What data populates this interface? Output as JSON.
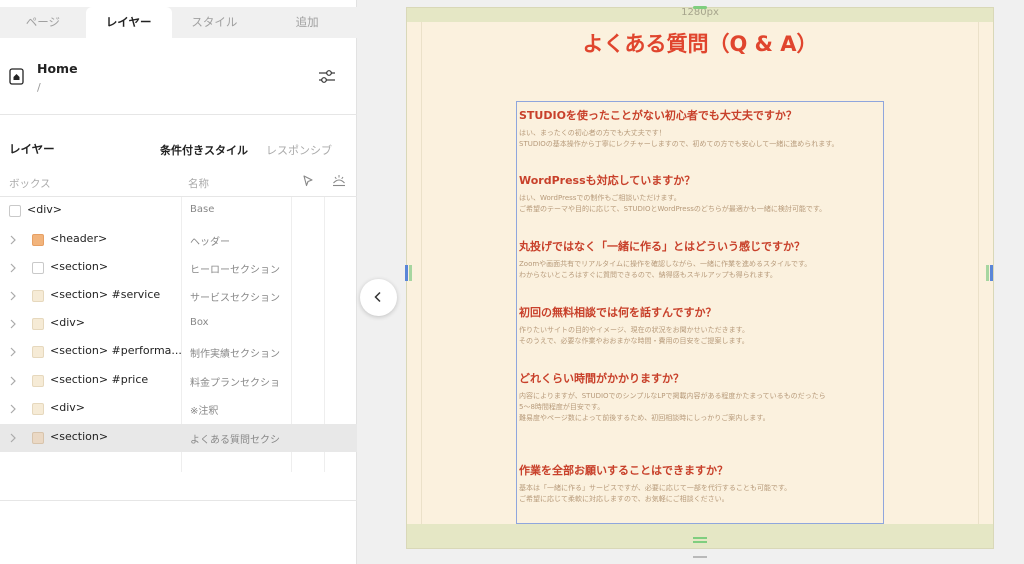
{
  "tabs": [
    {
      "label": "ページ"
    },
    {
      "label": "レイヤー"
    },
    {
      "label": "スタイル"
    },
    {
      "label": "追加"
    }
  ],
  "page": {
    "name": "Home",
    "path": "/"
  },
  "layer_panel": {
    "title": "レイヤー",
    "conditional_style": "条件付きスタイル",
    "responsive": "レスポンシブ",
    "col_box": "ボックス",
    "col_name": "名称"
  },
  "layers": [
    {
      "tag": "<div>",
      "name": "Base"
    },
    {
      "tag": "<header>",
      "name": "ヘッダー"
    },
    {
      "tag": "<section>",
      "name": "ヒーローセクション"
    },
    {
      "tag": "<section> #service",
      "name": "サービスセクション"
    },
    {
      "tag": "<div>",
      "name": "Box"
    },
    {
      "tag": "<section> #performa...",
      "name": "制作実績セクション"
    },
    {
      "tag": "<section> #price",
      "name": "料金プランセクショ"
    },
    {
      "tag": "<div>",
      "name": "※注釈"
    },
    {
      "tag": "<section>",
      "name": "よくある質問セクシ"
    }
  ],
  "canvas": {
    "width_label": "1280px",
    "title": "よくある質問（Q & A）",
    "faq": [
      {
        "q": "STUDIOを使ったことがない初心者でも大丈夫ですか？",
        "a": [
          "はい、まったくの初心者の方でも大丈夫です！",
          "STUDIOの基本操作から丁寧にレクチャーしますので、初めての方でも安心して一緒に進められます。"
        ]
      },
      {
        "q": "WordPressも対応していますか？",
        "a": [
          "はい、WordPressでの制作もご相談いただけます。",
          "ご希望のテーマや目的に応じて、STUDIOとWordPressのどちらが最適かも一緒に検討可能です。"
        ]
      },
      {
        "q": "丸投げではなく「一緒に作る」とはどういう感じですか？",
        "a": [
          "Zoomや画面共有でリアルタイムに操作を確認しながら、一緒に作業を進めるスタイルです。",
          "わからないところはすぐに質問できるので、納得感もスキルアップも得られます。"
        ]
      },
      {
        "q": "初回の無料相談では何を話すんですか？",
        "a": [
          "作りたいサイトの目的やイメージ、現在の状況をお聞かせいただきます。",
          "そのうえで、必要な作業やおおまかな時間・費用の目安をご提案します。"
        ]
      },
      {
        "q": "どれくらい時間がかかりますか？",
        "a": [
          "内容によりますが、STUDIOでのシンプルなLPで掲載内容がある程度かたまっているものだったら",
          "5〜8時間程度が目安です。",
          "難易度やページ数によって前後するため、初回相談時にしっかりご案内します。"
        ]
      },
      {
        "q": "作業を全部お願いすることはできますか？",
        "a": [
          "基本は「一緒に作る」サービスですが、必要に応じて一部を代行することも可能です。",
          "ご希望に応じて柔軟に対応しますので、お気軽にご相談ください。"
        ]
      }
    ]
  },
  "colors": {
    "accent_red": "#e0452e",
    "question_red": "#c8402a",
    "canvas_bg": "#fbf1de",
    "selection_blue": "#8fa6dd",
    "header_square": "#f2b47c",
    "section_square": "#f6ebd6"
  }
}
